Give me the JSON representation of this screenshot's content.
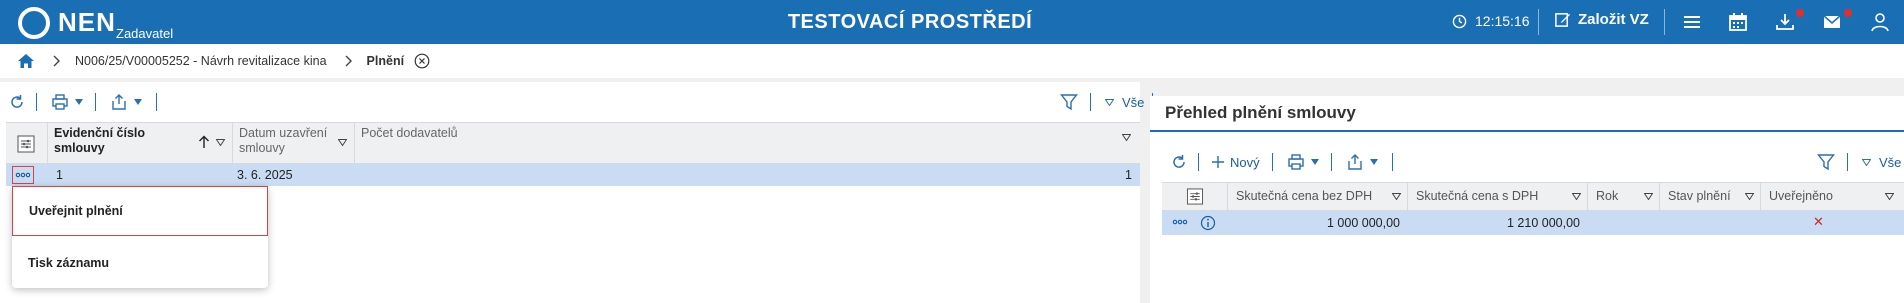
{
  "header": {
    "logo_text": "NEN",
    "logo_sub": "Zadavatel",
    "title": "TESTOVACÍ PROSTŘEDÍ",
    "time": "12:15:16",
    "create_label": "Založit VZ",
    "brand_color": "#1a6fb4",
    "icons": [
      "clock-icon",
      "edit-icon",
      "hamburger-menu-icon",
      "calendar-icon",
      "download-icon",
      "mail-icon",
      "user-icon"
    ]
  },
  "breadcrumb": {
    "items": [
      "N006/25/V00005252 - Návrh revitalizace kina",
      "Plnění"
    ]
  },
  "left_panel": {
    "filter_all": "Vše",
    "columns": [
      "Evidenční číslo smlouvy",
      "Datum uzavření smlouvy",
      "Počet dodavatelů"
    ],
    "rows": [
      {
        "number": "1",
        "date": "3. 6. 2025",
        "suppliers": "1"
      }
    ],
    "context_menu": [
      "Uveřejnit plnění",
      "Tisk záznamu"
    ]
  },
  "right_panel": {
    "title": "Přehled plnění smlouvy",
    "new_label": "Nový",
    "filter_all": "Vše",
    "columns": [
      "Skutečná cena bez DPH",
      "Skutečná cena s DPH",
      "Rok",
      "Stav plnění",
      "Uveřejněno"
    ],
    "rows": [
      {
        "price_without_vat": "1 000 000,00",
        "price_with_vat": "1 210 000,00",
        "year": "",
        "status": "",
        "published": "✕"
      }
    ]
  }
}
